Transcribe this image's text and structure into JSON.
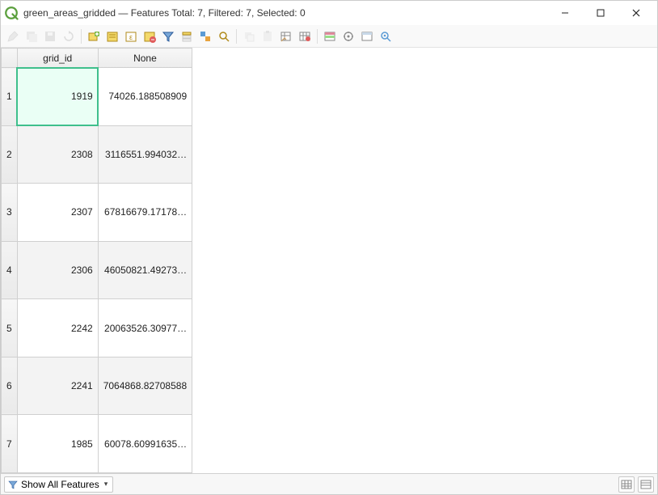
{
  "window": {
    "title": "green_areas_gridded — Features Total: 7, Filtered: 7, Selected: 0"
  },
  "columns": {
    "c1": "grid_id",
    "c2": "None"
  },
  "rows": [
    {
      "n": "1",
      "grid_id": "1919",
      "none": "74026.188508909"
    },
    {
      "n": "2",
      "grid_id": "2308",
      "none": "3116551.994032…"
    },
    {
      "n": "3",
      "grid_id": "2307",
      "none": "67816679.17178…"
    },
    {
      "n": "4",
      "grid_id": "2306",
      "none": "46050821.49273…"
    },
    {
      "n": "5",
      "grid_id": "2242",
      "none": "20063526.30977…"
    },
    {
      "n": "6",
      "grid_id": "2241",
      "none": "7064868.82708588"
    },
    {
      "n": "7",
      "grid_id": "1985",
      "none": "60078.60991635…"
    }
  ],
  "statusbar": {
    "show_all": "Show All Features"
  }
}
